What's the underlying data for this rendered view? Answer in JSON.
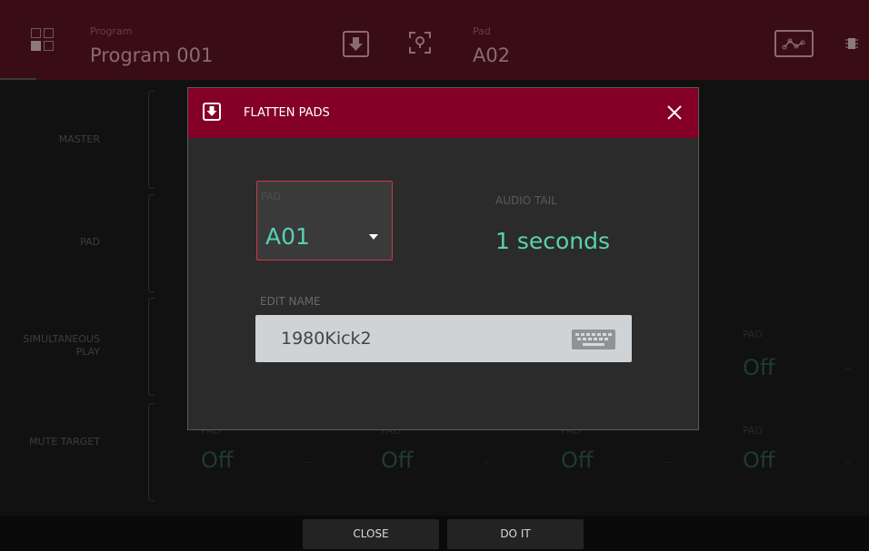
{
  "colors": {
    "accent": "#840027",
    "value_teal": "#58d2b0",
    "field_bg": "#cfd3d6"
  },
  "header": {
    "program_caption": "Program",
    "program_name": "Program 001",
    "pad_caption": "Pad",
    "pad_name": "A02",
    "icons": [
      "grid-icon",
      "flatten-icon",
      "pad-locate-icon",
      "envelope-icon",
      "chip-icon"
    ]
  },
  "rows": [
    {
      "label": "MASTER"
    },
    {
      "label": "PAD"
    },
    {
      "label": "SIMULTANEOUS PLAY"
    },
    {
      "label": "MUTE TARGET"
    }
  ],
  "simultaneous_cells": [
    {
      "caption": "PAD",
      "value": "Off"
    }
  ],
  "mute_cells": [
    {
      "caption": "PAD",
      "value": "Off"
    },
    {
      "caption": "PAD",
      "value": "Off"
    },
    {
      "caption": "PAD",
      "value": "Off"
    },
    {
      "caption": "PAD",
      "value": "Off"
    }
  ],
  "dialog": {
    "title": "FLATTEN PADS",
    "pad_label": "PAD",
    "pad_value": "A01",
    "tail_label": "AUDIO TAIL",
    "tail_value": "1 seconds",
    "name_label": "EDIT NAME",
    "name_value": "1980Kick2"
  },
  "footer": {
    "close_label": "CLOSE",
    "doit_label": "DO IT"
  }
}
